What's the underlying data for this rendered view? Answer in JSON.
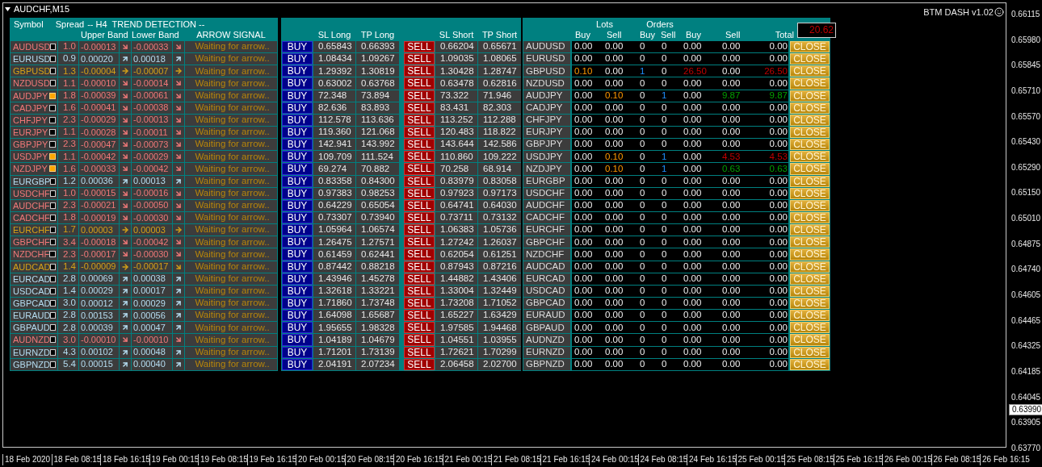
{
  "window": {
    "title": "AUDCHF,M15",
    "indicator": "BTM DASH v1.02"
  },
  "trend_header": {
    "symbol": "Symbol",
    "spread": "Spread",
    "title": "-- H4  TREND DETECTION --",
    "upper": "Upper Band",
    "lower": "Lower Band",
    "signal": "ARROW SIGNAL"
  },
  "levels_header": {
    "sl_long": "SL Long",
    "tp_long": "TP Long",
    "sl_short": "SL Short",
    "tp_short": "TP Short"
  },
  "orders_header": {
    "lots": "Lots",
    "orders": "Orders",
    "columns": [
      "Buy",
      "Sell",
      "Buy",
      "Sell",
      "Buy",
      "Sell",
      "Total"
    ],
    "total_profit": {
      "text": "20.62",
      "color": "#c00000"
    }
  },
  "rows": [
    {
      "symbol": "AUDUSD",
      "kind": "down",
      "checked": false,
      "spread": "1.0",
      "upper": {
        "text": "-0.00013",
        "kind": "down"
      },
      "lower": {
        "text": "-0.00033",
        "kind": "down"
      },
      "signal": "Waiting for arrow..",
      "buy": "BUY",
      "sl_long": "0.65843",
      "tp_long": "0.66393",
      "sell": "SELL",
      "sl_short": "0.66204",
      "tp_short": "0.65671",
      "dash_symbol": "AUDUSD",
      "buy_open": false,
      "sell_open": false,
      "lots_buy": "0.00",
      "lots_sell": "0.00",
      "orders_buy": "0",
      "orders_sell": "0",
      "profit_buy": "0.00",
      "profit_sell": "0.00",
      "total": "0.00",
      "losing": false,
      "winning": false,
      "close": "CLOSE"
    },
    {
      "symbol": "EURUSD",
      "kind": "up",
      "checked": false,
      "spread": "0.9",
      "upper": {
        "text": "0.00020",
        "kind": "up"
      },
      "lower": {
        "text": "0.00018",
        "kind": "up"
      },
      "signal": "Waiting for arrow..",
      "buy": "BUY",
      "sl_long": "1.08434",
      "tp_long": "1.09267",
      "sell": "SELL",
      "sl_short": "1.09035",
      "tp_short": "1.08065",
      "dash_symbol": "EURUSD",
      "buy_open": false,
      "sell_open": false,
      "lots_buy": "0.00",
      "lots_sell": "0.00",
      "orders_buy": "0",
      "orders_sell": "0",
      "profit_buy": "0.00",
      "profit_sell": "0.00",
      "total": "0.00",
      "losing": false,
      "winning": false,
      "close": "CLOSE"
    },
    {
      "symbol": "GBPUSD",
      "kind": "flat",
      "checked": false,
      "spread": "1.3",
      "upper": {
        "text": "-0.00004",
        "kind": "right"
      },
      "lower": {
        "text": "-0.00007",
        "kind": "right"
      },
      "signal": "Waiting for arrow..",
      "buy": "BUY",
      "sl_long": "1.29392",
      "tp_long": "1.30819",
      "sell": "SELL",
      "sl_short": "1.30428",
      "tp_short": "1.28747",
      "dash_symbol": "GBPUSD",
      "buy_open": true,
      "sell_open": false,
      "lots_buy": "0.10",
      "lots_sell": "0.00",
      "orders_buy": "1",
      "orders_sell": "0",
      "profit_buy": "26.50",
      "profit_sell": "0.00",
      "total": "26.50",
      "losing": true,
      "winning": false,
      "close": "CLOSE"
    },
    {
      "symbol": "NZDUSD",
      "kind": "down",
      "checked": false,
      "spread": "1.1",
      "upper": {
        "text": "-0.00010",
        "kind": "down"
      },
      "lower": {
        "text": "-0.00014",
        "kind": "down"
      },
      "signal": "Waiting for arrow..",
      "buy": "BUY",
      "sl_long": "0.63002",
      "tp_long": "0.63768",
      "sell": "SELL",
      "sl_short": "0.63478",
      "tp_short": "0.62816",
      "dash_symbol": "NZDUSD",
      "buy_open": false,
      "sell_open": false,
      "lots_buy": "0.00",
      "lots_sell": "0.00",
      "orders_buy": "0",
      "orders_sell": "0",
      "profit_buy": "0.00",
      "profit_sell": "0.00",
      "total": "0.00",
      "losing": false,
      "winning": false,
      "close": "CLOSE"
    },
    {
      "symbol": "AUDJPY",
      "kind": "down",
      "checked": true,
      "spread": "1.8",
      "upper": {
        "text": "-0.00039",
        "kind": "down"
      },
      "lower": {
        "text": "-0.00061",
        "kind": "down"
      },
      "signal": "Waiting for arrow..",
      "buy": "BUY",
      "sl_long": "72.348",
      "tp_long": "73.894",
      "sell": "SELL",
      "sl_short": "73.322",
      "tp_short": "71.946",
      "dash_symbol": "AUDJPY",
      "buy_open": false,
      "sell_open": true,
      "lots_buy": "0.00",
      "lots_sell": "0.10",
      "orders_buy": "0",
      "orders_sell": "1",
      "profit_buy": "0.00",
      "profit_sell": "9.87",
      "total": "9.87",
      "losing": false,
      "winning": true,
      "close": "CLOSE"
    },
    {
      "symbol": "CADJPY",
      "kind": "down",
      "checked": false,
      "spread": "1.6",
      "upper": {
        "text": "-0.00041",
        "kind": "down"
      },
      "lower": {
        "text": "-0.00038",
        "kind": "down"
      },
      "signal": "Waiting for arrow..",
      "buy": "BUY",
      "sl_long": "82.636",
      "tp_long": "83.893",
      "sell": "SELL",
      "sl_short": "83.431",
      "tp_short": "82.303",
      "dash_symbol": "CADJPY",
      "buy_open": false,
      "sell_open": false,
      "lots_buy": "0.00",
      "lots_sell": "0.00",
      "orders_buy": "0",
      "orders_sell": "0",
      "profit_buy": "0.00",
      "profit_sell": "0.00",
      "total": "0.00",
      "losing": false,
      "winning": false,
      "close": "CLOSE"
    },
    {
      "symbol": "CHFJPY",
      "kind": "down",
      "checked": false,
      "spread": "2.3",
      "upper": {
        "text": "-0.00029",
        "kind": "down"
      },
      "lower": {
        "text": "-0.00013",
        "kind": "down"
      },
      "signal": "Waiting for arrow..",
      "buy": "BUY",
      "sl_long": "112.578",
      "tp_long": "113.636",
      "sell": "SELL",
      "sl_short": "113.252",
      "tp_short": "112.288",
      "dash_symbol": "CHFJPY",
      "buy_open": false,
      "sell_open": false,
      "lots_buy": "0.00",
      "lots_sell": "0.00",
      "orders_buy": "0",
      "orders_sell": "0",
      "profit_buy": "0.00",
      "profit_sell": "0.00",
      "total": "0.00",
      "losing": false,
      "winning": false,
      "close": "CLOSE"
    },
    {
      "symbol": "EURJPY",
      "kind": "down",
      "checked": false,
      "spread": "1.1",
      "upper": {
        "text": "-0.00028",
        "kind": "down"
      },
      "lower": {
        "text": "-0.00011",
        "kind": "down"
      },
      "signal": "Waiting for arrow..",
      "buy": "BUY",
      "sl_long": "119.360",
      "tp_long": "121.068",
      "sell": "SELL",
      "sl_short": "120.483",
      "tp_short": "118.822",
      "dash_symbol": "EURJPY",
      "buy_open": false,
      "sell_open": false,
      "lots_buy": "0.00",
      "lots_sell": "0.00",
      "orders_buy": "0",
      "orders_sell": "0",
      "profit_buy": "0.00",
      "profit_sell": "0.00",
      "total": "0.00",
      "losing": false,
      "winning": false,
      "close": "CLOSE"
    },
    {
      "symbol": "GBPJPY",
      "kind": "down",
      "checked": false,
      "spread": "2.3",
      "upper": {
        "text": "-0.00047",
        "kind": "down"
      },
      "lower": {
        "text": "-0.00073",
        "kind": "down"
      },
      "signal": "Waiting for arrow..",
      "buy": "BUY",
      "sl_long": "142.941",
      "tp_long": "143.992",
      "sell": "SELL",
      "sl_short": "143.644",
      "tp_short": "142.586",
      "dash_symbol": "GBPJPY",
      "buy_open": false,
      "sell_open": false,
      "lots_buy": "0.00",
      "lots_sell": "0.00",
      "orders_buy": "0",
      "orders_sell": "0",
      "profit_buy": "0.00",
      "profit_sell": "0.00",
      "total": "0.00",
      "losing": false,
      "winning": false,
      "close": "CLOSE"
    },
    {
      "symbol": "USDJPY",
      "kind": "down",
      "checked": true,
      "spread": "1.1",
      "upper": {
        "text": "-0.00042",
        "kind": "down"
      },
      "lower": {
        "text": "-0.00029",
        "kind": "down"
      },
      "signal": "Waiting for arrow..",
      "buy": "BUY",
      "sl_long": "109.709",
      "tp_long": "111.524",
      "sell": "SELL",
      "sl_short": "110.860",
      "tp_short": "109.222",
      "dash_symbol": "USDJPY",
      "buy_open": false,
      "sell_open": true,
      "lots_buy": "0.00",
      "lots_sell": "0.10",
      "orders_buy": "0",
      "orders_sell": "1",
      "profit_buy": "0.00",
      "profit_sell": "4.53",
      "total": "4.53",
      "losing": true,
      "winning": false,
      "close": "CLOSE"
    },
    {
      "symbol": "NZDJPY",
      "kind": "down",
      "checked": true,
      "spread": "1.6",
      "upper": {
        "text": "-0.00033",
        "kind": "down"
      },
      "lower": {
        "text": "-0.00042",
        "kind": "down"
      },
      "signal": "Waiting for arrow..",
      "buy": "BUY",
      "sl_long": "69.274",
      "tp_long": "70.882",
      "sell": "SELL",
      "sl_short": "70.258",
      "tp_short": "68.914",
      "dash_symbol": "NZDJPY",
      "buy_open": false,
      "sell_open": true,
      "lots_buy": "0.00",
      "lots_sell": "0.10",
      "orders_buy": "0",
      "orders_sell": "1",
      "profit_buy": "0.00",
      "profit_sell": "0.63",
      "total": "0.63",
      "losing": false,
      "winning": true,
      "close": "CLOSE"
    },
    {
      "symbol": "EURGBP",
      "kind": "up",
      "checked": false,
      "spread": "1.2",
      "upper": {
        "text": "0.00036",
        "kind": "up"
      },
      "lower": {
        "text": "0.00013",
        "kind": "up"
      },
      "signal": "Waiting for arrow..",
      "buy": "BUY",
      "sl_long": "0.83358",
      "tp_long": "0.84300",
      "sell": "SELL",
      "sl_short": "0.83979",
      "tp_short": "0.83058",
      "dash_symbol": "EURGBP",
      "buy_open": false,
      "sell_open": false,
      "lots_buy": "0.00",
      "lots_sell": "0.00",
      "orders_buy": "0",
      "orders_sell": "0",
      "profit_buy": "0.00",
      "profit_sell": "0.00",
      "total": "0.00",
      "losing": false,
      "winning": false,
      "close": "CLOSE"
    },
    {
      "symbol": "USDCHF",
      "kind": "down",
      "checked": false,
      "spread": "1.0",
      "upper": {
        "text": "-0.00015",
        "kind": "down"
      },
      "lower": {
        "text": "-0.00016",
        "kind": "down"
      },
      "signal": "Waiting for arrow..",
      "buy": "BUY",
      "sl_long": "0.97383",
      "tp_long": "0.98253",
      "sell": "SELL",
      "sl_short": "0.97923",
      "tp_short": "0.97173",
      "dash_symbol": "USDCHF",
      "buy_open": false,
      "sell_open": false,
      "lots_buy": "0.00",
      "lots_sell": "0.00",
      "orders_buy": "0",
      "orders_sell": "0",
      "profit_buy": "0.00",
      "profit_sell": "0.00",
      "total": "0.00",
      "losing": false,
      "winning": false,
      "close": "CLOSE"
    },
    {
      "symbol": "AUDCHF",
      "kind": "down",
      "checked": false,
      "spread": "2.3",
      "upper": {
        "text": "-0.00021",
        "kind": "down"
      },
      "lower": {
        "text": "-0.00050",
        "kind": "down"
      },
      "signal": "Waiting for arrow..",
      "buy": "BUY",
      "sl_long": "0.64229",
      "tp_long": "0.65054",
      "sell": "SELL",
      "sl_short": "0.64741",
      "tp_short": "0.64030",
      "dash_symbol": "AUDCHF",
      "buy_open": false,
      "sell_open": false,
      "lots_buy": "0.00",
      "lots_sell": "0.00",
      "orders_buy": "0",
      "orders_sell": "0",
      "profit_buy": "0.00",
      "profit_sell": "0.00",
      "total": "0.00",
      "losing": false,
      "winning": false,
      "close": "CLOSE"
    },
    {
      "symbol": "CADCHF",
      "kind": "down",
      "checked": false,
      "spread": "1.8",
      "upper": {
        "text": "-0.00019",
        "kind": "down"
      },
      "lower": {
        "text": "-0.00030",
        "kind": "down"
      },
      "signal": "Waiting for arrow..",
      "buy": "BUY",
      "sl_long": "0.73307",
      "tp_long": "0.73940",
      "sell": "SELL",
      "sl_short": "0.73711",
      "tp_short": "0.73132",
      "dash_symbol": "CADCHF",
      "buy_open": false,
      "sell_open": false,
      "lots_buy": "0.00",
      "lots_sell": "0.00",
      "orders_buy": "0",
      "orders_sell": "0",
      "profit_buy": "0.00",
      "profit_sell": "0.00",
      "total": "0.00",
      "losing": false,
      "winning": false,
      "close": "CLOSE"
    },
    {
      "symbol": "EURCHF",
      "kind": "flat",
      "checked": false,
      "spread": "1.7",
      "upper": {
        "text": "0.00003",
        "kind": "right"
      },
      "lower": {
        "text": "0.00003",
        "kind": "right"
      },
      "signal": "Waiting for arrow..",
      "buy": "BUY",
      "sl_long": "1.05964",
      "tp_long": "1.06574",
      "sell": "SELL",
      "sl_short": "1.06383",
      "tp_short": "1.05736",
      "dash_symbol": "EURCHF",
      "buy_open": false,
      "sell_open": false,
      "lots_buy": "0.00",
      "lots_sell": "0.00",
      "orders_buy": "0",
      "orders_sell": "0",
      "profit_buy": "0.00",
      "profit_sell": "0.00",
      "total": "0.00",
      "losing": false,
      "winning": false,
      "close": "CLOSE"
    },
    {
      "symbol": "GBPCHF",
      "kind": "down",
      "checked": false,
      "spread": "3.4",
      "upper": {
        "text": "-0.00018",
        "kind": "down"
      },
      "lower": {
        "text": "-0.00042",
        "kind": "down"
      },
      "signal": "Waiting for arrow..",
      "buy": "BUY",
      "sl_long": "1.26475",
      "tp_long": "1.27571",
      "sell": "SELL",
      "sl_short": "1.27242",
      "tp_short": "1.26037",
      "dash_symbol": "GBPCHF",
      "buy_open": false,
      "sell_open": false,
      "lots_buy": "0.00",
      "lots_sell": "0.00",
      "orders_buy": "0",
      "orders_sell": "0",
      "profit_buy": "0.00",
      "profit_sell": "0.00",
      "total": "0.00",
      "losing": false,
      "winning": false,
      "close": "CLOSE"
    },
    {
      "symbol": "NZDCHF",
      "kind": "down",
      "checked": false,
      "spread": "2.3",
      "upper": {
        "text": "-0.00017",
        "kind": "down"
      },
      "lower": {
        "text": "-0.00030",
        "kind": "down"
      },
      "signal": "Waiting for arrow..",
      "buy": "BUY",
      "sl_long": "0.61459",
      "tp_long": "0.62441",
      "sell": "SELL",
      "sl_short": "0.62054",
      "tp_short": "0.61251",
      "dash_symbol": "NZDCHF",
      "buy_open": false,
      "sell_open": false,
      "lots_buy": "0.00",
      "lots_sell": "0.00",
      "orders_buy": "0",
      "orders_sell": "0",
      "profit_buy": "0.00",
      "profit_sell": "0.00",
      "total": "0.00",
      "losing": false,
      "winning": false,
      "close": "CLOSE"
    },
    {
      "symbol": "AUDCAD",
      "kind": "flat",
      "checked": false,
      "spread": "1.4",
      "upper": {
        "text": "-0.00009",
        "kind": "right"
      },
      "lower": {
        "text": "-0.00017",
        "kind": "down"
      },
      "signal": "Waiting for arrow..",
      "buy": "BUY",
      "sl_long": "0.87442",
      "tp_long": "0.88218",
      "sell": "SELL",
      "sl_short": "0.87943",
      "tp_short": "0.87216",
      "dash_symbol": "AUDCAD",
      "buy_open": false,
      "sell_open": false,
      "lots_buy": "0.00",
      "lots_sell": "0.00",
      "orders_buy": "0",
      "orders_sell": "0",
      "profit_buy": "0.00",
      "profit_sell": "0.00",
      "total": "0.00",
      "losing": false,
      "winning": false,
      "close": "CLOSE"
    },
    {
      "symbol": "EURCAD",
      "kind": "up",
      "checked": false,
      "spread": "2.8",
      "upper": {
        "text": "0.00069",
        "kind": "up"
      },
      "lower": {
        "text": "0.00038",
        "kind": "up"
      },
      "signal": "Waiting for arrow..",
      "buy": "BUY",
      "sl_long": "1.43946",
      "tp_long": "1.45278",
      "sell": "SELL",
      "sl_short": "1.44882",
      "tp_short": "1.43406",
      "dash_symbol": "EURCAD",
      "buy_open": false,
      "sell_open": false,
      "lots_buy": "0.00",
      "lots_sell": "0.00",
      "orders_buy": "0",
      "orders_sell": "0",
      "profit_buy": "0.00",
      "profit_sell": "0.00",
      "total": "0.00",
      "losing": false,
      "winning": false,
      "close": "CLOSE"
    },
    {
      "symbol": "USDCAD",
      "kind": "up",
      "checked": false,
      "spread": "1.4",
      "upper": {
        "text": "0.00029",
        "kind": "up"
      },
      "lower": {
        "text": "0.00017",
        "kind": "up"
      },
      "signal": "Waiting for arrow..",
      "buy": "BUY",
      "sl_long": "1.32618",
      "tp_long": "1.33221",
      "sell": "SELL",
      "sl_short": "1.33004",
      "tp_short": "1.32449",
      "dash_symbol": "USDCAD",
      "buy_open": false,
      "sell_open": false,
      "lots_buy": "0.00",
      "lots_sell": "0.00",
      "orders_buy": "0",
      "orders_sell": "0",
      "profit_buy": "0.00",
      "profit_sell": "0.00",
      "total": "0.00",
      "losing": false,
      "winning": false,
      "close": "CLOSE"
    },
    {
      "symbol": "GBPCAD",
      "kind": "up",
      "checked": false,
      "spread": "3.0",
      "upper": {
        "text": "0.00012",
        "kind": "up"
      },
      "lower": {
        "text": "0.00029",
        "kind": "up"
      },
      "signal": "Waiting for arrow..",
      "buy": "BUY",
      "sl_long": "1.71860",
      "tp_long": "1.73748",
      "sell": "SELL",
      "sl_short": "1.73208",
      "tp_short": "1.71052",
      "dash_symbol": "GBPCAD",
      "buy_open": false,
      "sell_open": false,
      "lots_buy": "0.00",
      "lots_sell": "0.00",
      "orders_buy": "0",
      "orders_sell": "0",
      "profit_buy": "0.00",
      "profit_sell": "0.00",
      "total": "0.00",
      "losing": false,
      "winning": false,
      "close": "CLOSE"
    },
    {
      "symbol": "EURAUD",
      "kind": "up",
      "checked": false,
      "spread": "2.8",
      "upper": {
        "text": "0.00153",
        "kind": "up"
      },
      "lower": {
        "text": "0.00056",
        "kind": "up"
      },
      "signal": "Waiting for arrow..",
      "buy": "BUY",
      "sl_long": "1.64098",
      "tp_long": "1.65687",
      "sell": "SELL",
      "sl_short": "1.65227",
      "tp_short": "1.63429",
      "dash_symbol": "EURAUD",
      "buy_open": false,
      "sell_open": false,
      "lots_buy": "0.00",
      "lots_sell": "0.00",
      "orders_buy": "0",
      "orders_sell": "0",
      "profit_buy": "0.00",
      "profit_sell": "0.00",
      "total": "0.00",
      "losing": false,
      "winning": false,
      "close": "CLOSE"
    },
    {
      "symbol": "GBPAUD",
      "kind": "up",
      "checked": false,
      "spread": "2.8",
      "upper": {
        "text": "0.00039",
        "kind": "up"
      },
      "lower": {
        "text": "0.00047",
        "kind": "up"
      },
      "signal": "Waiting for arrow..",
      "buy": "BUY",
      "sl_long": "1.95655",
      "tp_long": "1.98328",
      "sell": "SELL",
      "sl_short": "1.97585",
      "tp_short": "1.94468",
      "dash_symbol": "GBPAUD",
      "buy_open": false,
      "sell_open": false,
      "lots_buy": "0.00",
      "lots_sell": "0.00",
      "orders_buy": "0",
      "orders_sell": "0",
      "profit_buy": "0.00",
      "profit_sell": "0.00",
      "total": "0.00",
      "losing": false,
      "winning": false,
      "close": "CLOSE"
    },
    {
      "symbol": "AUDNZD",
      "kind": "down",
      "checked": false,
      "spread": "3.0",
      "upper": {
        "text": "-0.00010",
        "kind": "down"
      },
      "lower": {
        "text": "-0.00010",
        "kind": "down"
      },
      "signal": "Waiting for arrow..",
      "buy": "BUY",
      "sl_long": "1.04189",
      "tp_long": "1.04679",
      "sell": "SELL",
      "sl_short": "1.04551",
      "tp_short": "1.03955",
      "dash_symbol": "AUDNZD",
      "buy_open": false,
      "sell_open": false,
      "lots_buy": "0.00",
      "lots_sell": "0.00",
      "orders_buy": "0",
      "orders_sell": "0",
      "profit_buy": "0.00",
      "profit_sell": "0.00",
      "total": "0.00",
      "losing": false,
      "winning": false,
      "close": "CLOSE"
    },
    {
      "symbol": "EURNZD",
      "kind": "up",
      "checked": false,
      "spread": "4.3",
      "upper": {
        "text": "0.00102",
        "kind": "up"
      },
      "lower": {
        "text": "0.00048",
        "kind": "up"
      },
      "signal": "Waiting for arrow..",
      "buy": "BUY",
      "sl_long": "1.71201",
      "tp_long": "1.73139",
      "sell": "SELL",
      "sl_short": "1.72621",
      "tp_short": "1.70299",
      "dash_symbol": "EURNZD",
      "buy_open": false,
      "sell_open": false,
      "lots_buy": "0.00",
      "lots_sell": "0.00",
      "orders_buy": "0",
      "orders_sell": "0",
      "profit_buy": "0.00",
      "profit_sell": "0.00",
      "total": "0.00",
      "losing": false,
      "winning": false,
      "close": "CLOSE"
    },
    {
      "symbol": "GBPNZD",
      "kind": "up",
      "checked": false,
      "spread": "5.4",
      "upper": {
        "text": "0.00015",
        "kind": "up"
      },
      "lower": {
        "text": "0.00040",
        "kind": "up"
      },
      "signal": "Waiting for arrow..",
      "buy": "BUY",
      "sl_long": "2.04191",
      "tp_long": "2.07234",
      "sell": "SELL",
      "sl_short": "2.06458",
      "tp_short": "2.02700",
      "dash_symbol": "GBPNZD",
      "buy_open": false,
      "sell_open": false,
      "lots_buy": "0.00",
      "lots_sell": "0.00",
      "orders_buy": "0",
      "orders_sell": "0",
      "profit_buy": "0.00",
      "profit_sell": "0.00",
      "total": "0.00",
      "losing": false,
      "winning": false,
      "close": "CLOSE"
    }
  ],
  "price_axis": [
    "0.66115",
    "0.65980",
    "0.65845",
    "0.65710",
    "0.65570",
    "0.65430",
    "0.65290",
    "0.65150",
    "0.65010",
    "0.64875",
    "0.64740",
    "0.64605",
    "0.64465",
    "0.64325",
    "0.64185",
    "0.64045",
    "0.63905",
    "0.63770"
  ],
  "current_price": "0.63990",
  "time_axis": [
    "18 Feb 2020",
    "18 Feb 08:15",
    "18 Feb 16:15",
    "19 Feb 00:15",
    "19 Feb 08:15",
    "19 Feb 16:15",
    "20 Feb 00:15",
    "20 Feb 08:15",
    "20 Feb 16:15",
    "21 Feb 00:15",
    "21 Feb 08:15",
    "21 Feb 16:15",
    "24 Feb 00:15",
    "24 Feb 08:15",
    "24 Feb 16:15",
    "25 Feb 00:15",
    "25 Feb 08:15",
    "25 Feb 16:15",
    "26 Feb 00:15",
    "26 Feb 08:15",
    "26 Feb 16:15"
  ]
}
